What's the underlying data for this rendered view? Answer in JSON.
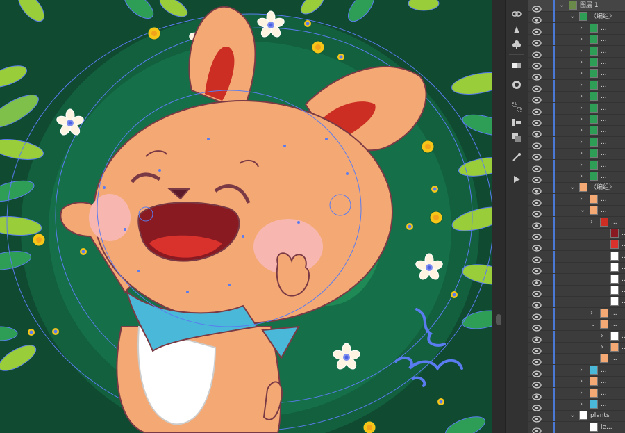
{
  "layers_panel": {
    "top_layer_name": "图层 1",
    "group1_name": "〈编组〉",
    "group2_name": "〈编组〉",
    "plants_name": "plants",
    "plants_child_name": "le...",
    "ellipsis": "..."
  },
  "colors": {
    "bg_green": "#0f4a31",
    "mid_green": "#14744a",
    "leaf_light": "#9acd3a",
    "leaf_dark": "#2e9e56",
    "bunny_body": "#f4a974",
    "bunny_outline": "#7a3a45",
    "ear_inner": "#cc2e24",
    "cheek": "#f7b7b0",
    "mouth": "#8a1a22",
    "tongue": "#d9312c",
    "scarf": "#4ab8d8",
    "flower_center": "#f5c518",
    "selection_blue": "#5a7cf0",
    "panel_bg": "#3c3c3c",
    "toolbar_bg": "#323232"
  },
  "icons": [
    "link-icon",
    "puppet-warp-icon",
    "symbol-icon",
    "gradient-icon",
    "appearance-icon",
    "align-icon",
    "transform-icon",
    "pathfinder-icon",
    "magic-wand-icon",
    "play-icon"
  ]
}
